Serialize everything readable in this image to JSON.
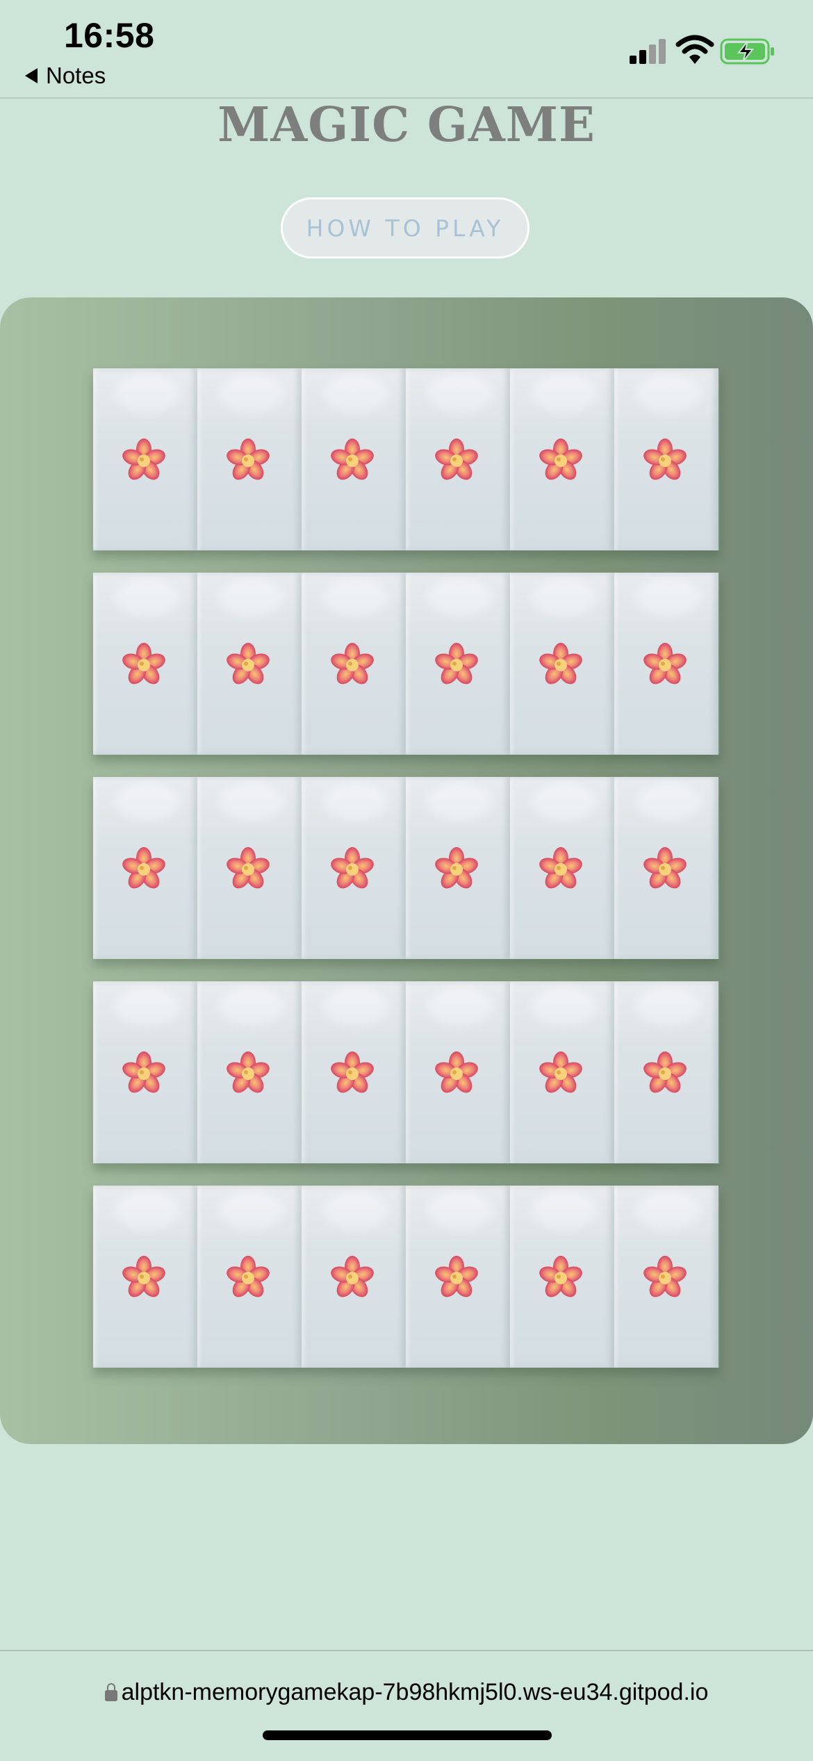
{
  "status_bar": {
    "time": "16:58",
    "back_label": "Notes",
    "battery_color": "#5bc45b"
  },
  "game": {
    "title": "MAGIC GAME",
    "how_to_play_label": "HOW TO PLAY",
    "board_gradient": [
      "#a7c0a3",
      "#76897a"
    ],
    "rows": 5,
    "cols": 6,
    "card_state": "face-down",
    "card_icon": "flower-icon"
  },
  "browser": {
    "url": "alptkn-memorygamekap-7b98hkmj5l0.ws-eu34.gitpod.io"
  }
}
